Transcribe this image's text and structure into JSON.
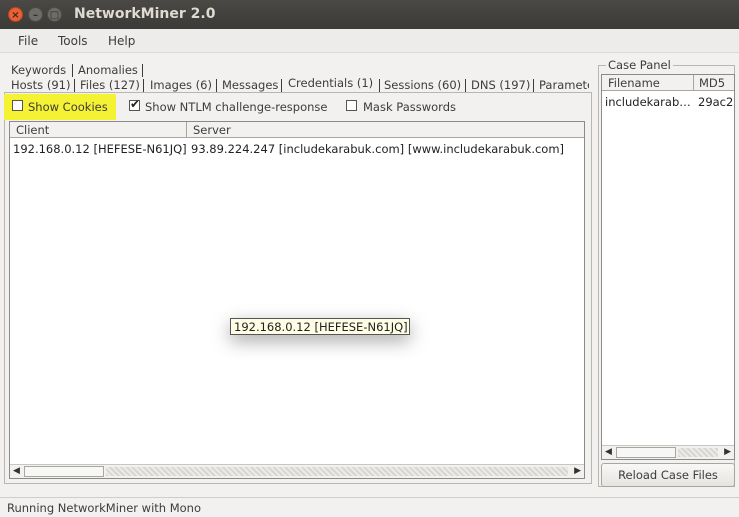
{
  "window": {
    "title": "NetworkMiner 2.0"
  },
  "menu": [
    "File",
    "Tools",
    "Help"
  ],
  "tabs_row1": [
    "Keywords",
    "Anomalies"
  ],
  "tabs_row2": [
    "Hosts (91)",
    "Files (127)",
    "Images (6)",
    "Messages",
    "Credentials (1)",
    "Sessions (60)",
    "DNS (197)",
    "Paramete"
  ],
  "active_tab": "Credentials (1)",
  "options": {
    "show_cookies": {
      "label": "Show Cookies",
      "checked": false
    },
    "show_ntlm": {
      "label": "Show NTLM challenge-response",
      "checked": true
    },
    "mask_passwords": {
      "label": "Mask Passwords",
      "checked": false
    }
  },
  "credentials_table": {
    "columns": [
      "Client",
      "Server"
    ],
    "rows": [
      {
        "client": "192.168.0.12 [HEFESE-N61JQ]",
        "server": "93.89.224.247 [includekarabuk.com] [www.includekarabuk.com]"
      }
    ]
  },
  "tooltip": "192.168.0.12 [HEFESE-N61JQ]",
  "case_panel": {
    "title": "Case Panel",
    "columns": [
      "Filename",
      "MD5"
    ],
    "rows": [
      {
        "filename": "includekarab…",
        "md5": "29ac2"
      }
    ],
    "reload_button": "Reload Case Files"
  },
  "status": "Running NetworkMiner with Mono",
  "colors": {
    "highlight": "#f4f233",
    "title_bar": "#3c3b37",
    "close_button": "#e95f36"
  },
  "icons": {
    "close": "close-icon",
    "minimize": "minimize-icon",
    "maximize": "maximize-icon",
    "checkmark": "checkmark-icon"
  }
}
